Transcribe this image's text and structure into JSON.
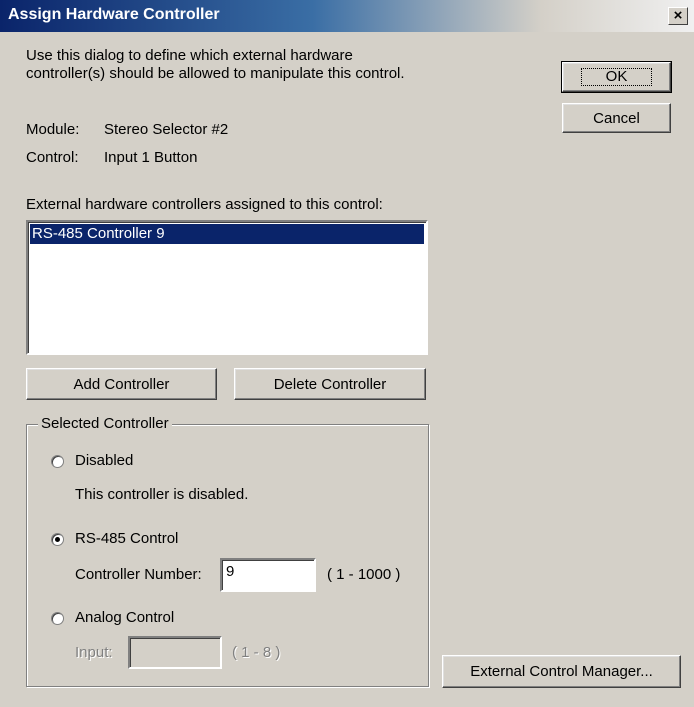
{
  "window": {
    "title": "Assign Hardware Controller",
    "close_glyph": "×"
  },
  "intro": {
    "line1": "Use this dialog to define which external hardware",
    "line2": "controller(s) should be allowed to manipulate this control."
  },
  "info": {
    "module_label": "Module:",
    "module_value": "Stereo Selector #2",
    "control_label": "Control:",
    "control_value": "Input 1 Button"
  },
  "buttons": {
    "ok": "OK",
    "cancel": "Cancel",
    "add": "Add Controller",
    "delete": "Delete Controller",
    "manager": "External Control Manager..."
  },
  "list": {
    "label": "External hardware controllers assigned to this control:",
    "items": [
      "RS-485 Controller 9"
    ]
  },
  "selected": {
    "group_label": "Selected Controller",
    "disabled_label": "Disabled",
    "disabled_desc": "This controller is disabled.",
    "rs485_label": "RS-485 Control",
    "controller_number_label": "Controller Number:",
    "controller_number_value": "9",
    "controller_number_range": "( 1 - 1000 )",
    "analog_label": "Analog Control",
    "input_label": "Input:",
    "input_value": "",
    "input_range": "( 1 - 8 )",
    "selected_option": "RS-485 Control"
  }
}
